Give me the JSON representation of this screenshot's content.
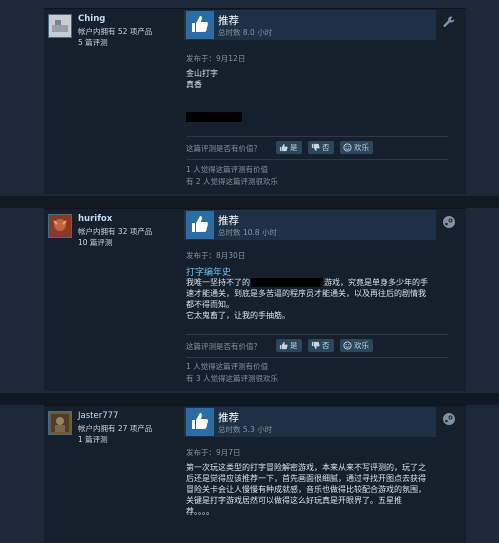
{
  "reviews": [
    {
      "user": {
        "name": "Ching",
        "products": "帐户内拥有 52 项产品",
        "review_count": "5 篇评测",
        "avatar_color": "#c9ccd0"
      },
      "vote": {
        "title": "推荐",
        "hours": "总时数 8.0 小时",
        "platform_icon": "wrench-icon"
      },
      "posted": "发布于：9月12日",
      "game_link": "",
      "body_lines": [
        "金山打字",
        "真香"
      ],
      "helpful_prompt": "这篇评测是否有价值？",
      "buttons": {
        "yes": "是",
        "no": "否",
        "funny": "欢乐"
      },
      "stats": [
        "1 人觉得这篇评测有价值",
        "有 2 人觉得这篇评测很欢乐"
      ]
    },
    {
      "user": {
        "name": "hurifox",
        "products": "帐户内拥有 32 项产品",
        "review_count": "10 篇评测",
        "avatar_color": "#8a3a24"
      },
      "vote": {
        "title": "推荐",
        "hours": "总时数 10.8 小时",
        "platform_icon": "steam-icon"
      },
      "posted": "发布于：8月30日",
      "game_link": "打字编年史",
      "body_lines": [
        "我唯一坚持不了的",
        "游戏，究竟是单身多少年的手",
        "速才能通关，到底是多苦逼的程序员才能通关，以及再往后的剧情我",
        "都不得而知。",
        "它太鬼畜了，让我的手抽筋。"
      ],
      "helpful_prompt": "这篇评测是否有价值？",
      "buttons": {
        "yes": "是",
        "no": "否",
        "funny": "欢乐"
      },
      "stats": [
        "1 人觉得这篇评测有价值",
        "有 3 人觉得这篇评测很欢乐"
      ]
    },
    {
      "user": {
        "name": "Jaster777",
        "products": "帐户内拥有 27 项产品",
        "review_count": "1 篇评测",
        "avatar_color": "#6a5a3a"
      },
      "vote": {
        "title": "推荐",
        "hours": "总时数 5.3 小时",
        "platform_icon": "steam-icon"
      },
      "posted": "发布于：9月7日",
      "game_link": "",
      "body_lines": [
        "第一次玩这类型的打字冒险解密游戏，本来从来不写评测的，玩了之",
        "后还是觉得应该推荐一下，首先画面很细腻，通过寻找开图点去获得",
        "冒险关卡会让人慢慢有种成就感，音乐也做得比较配合游戏的氛围，",
        "关键是打字游戏居然可以做得这么好玩真是开眼界了。五星推",
        "荐。。。。"
      ]
    }
  ],
  "colors": {
    "background": "#1b2838",
    "card": "#16202d",
    "vote_box": "#1e3144",
    "thumb": "#2b6ea6",
    "link": "#66c0f4",
    "button": "#2a475e"
  }
}
